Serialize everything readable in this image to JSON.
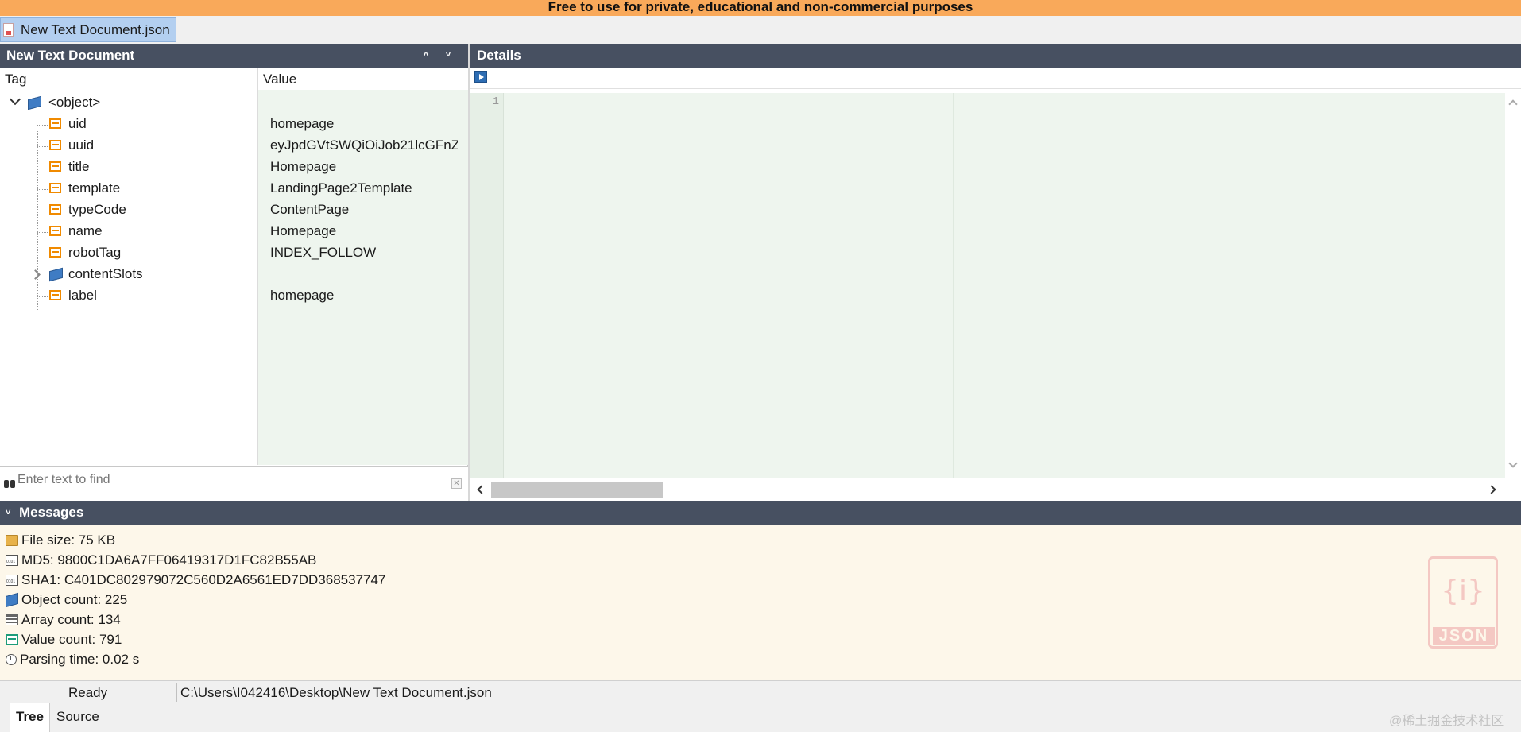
{
  "banner": "Free to use for private, educational and non-commercial  purposes",
  "document_tab": {
    "label": "New Text Document.json"
  },
  "tree_panel": {
    "title": "New Text Document",
    "col_tag": "Tag",
    "col_value": "Value",
    "root": "<object>",
    "rows": [
      {
        "tag": "uid",
        "value": "homepage",
        "kind": "value"
      },
      {
        "tag": "uuid",
        "value": "eyJpdGVtSWQiOiJob21lcGFnZ...",
        "kind": "value"
      },
      {
        "tag": "title",
        "value": "Homepage",
        "kind": "value"
      },
      {
        "tag": "template",
        "value": "LandingPage2Template",
        "kind": "value"
      },
      {
        "tag": "typeCode",
        "value": "ContentPage",
        "kind": "value"
      },
      {
        "tag": "name",
        "value": "Homepage",
        "kind": "value"
      },
      {
        "tag": "robotTag",
        "value": "INDEX_FOLLOW",
        "kind": "value"
      },
      {
        "tag": "contentSlots",
        "value": "",
        "kind": "object"
      },
      {
        "tag": "label",
        "value": "homepage",
        "kind": "value"
      }
    ],
    "search_placeholder": "Enter text to find"
  },
  "details_panel": {
    "title": "Details",
    "line_number": "1"
  },
  "messages": {
    "title": "Messages",
    "items": [
      {
        "icon": "folder-icon",
        "text": "File size: 75 KB"
      },
      {
        "icon": "md5-hash-icon",
        "text": "MD5: 9800C1DA6A7FF06419317D1FC82B55AB"
      },
      {
        "icon": "sha1-hash-icon",
        "text": "SHA1: C401DC802979072C560D2A6561ED7DD368537747"
      },
      {
        "icon": "object-icon",
        "text": "Object count: 225"
      },
      {
        "icon": "array-icon",
        "text": "Array count: 134"
      },
      {
        "icon": "value-icon",
        "text": "Value count: 791"
      },
      {
        "icon": "clock-icon",
        "text": "Parsing time: 0.02 s"
      }
    ],
    "logo_label": "JSON",
    "logo_braces": "{i}"
  },
  "status_bar": {
    "state": "Ready",
    "path": "C:\\Users\\I042416\\Desktop\\New Text Document.json"
  },
  "bottom_tabs": {
    "tree": "Tree",
    "source": "Source"
  },
  "watermark": "@稀土掘金技术社区",
  "colors": {
    "banner": "#f9a95a",
    "header": "#475061",
    "value_bg": "#eef5ee",
    "messages_bg": "#fdf7ea"
  }
}
